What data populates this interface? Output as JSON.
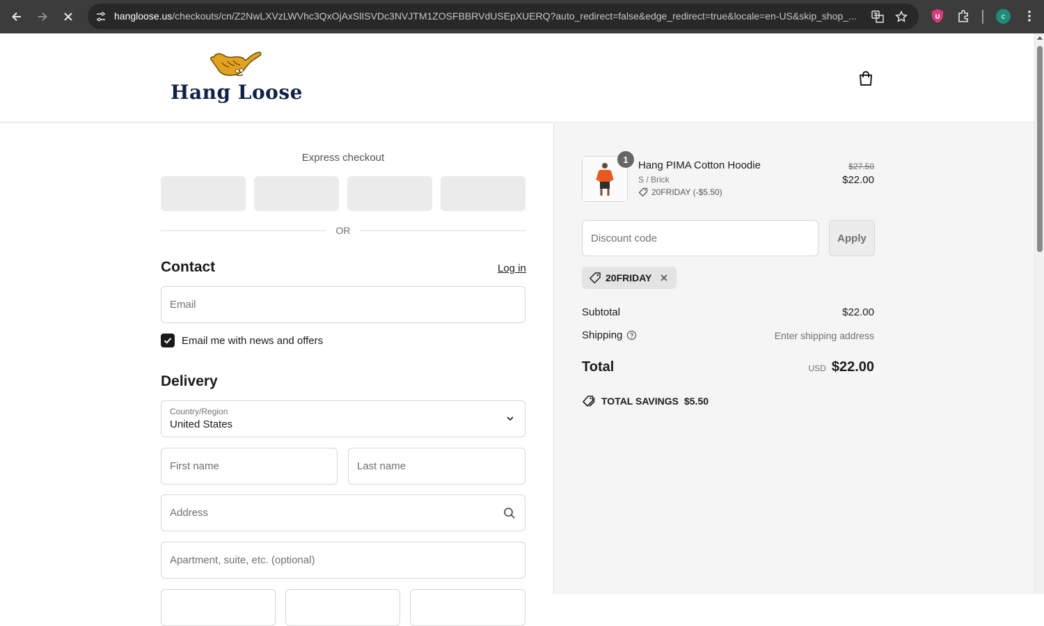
{
  "browser": {
    "url_host": "hangloose.us",
    "url_path": "/checkouts/cn/Z2NwLXVzLWVhc3QxOjAxSlISVDc3NVJTM1ZOSFBBRVdUSEpXUERQ?auto_redirect=false&edge_redirect=true&locale=en-US&skip_shop_...",
    "profile_initial": "c"
  },
  "shop": {
    "logo_text": "Hang Loose"
  },
  "express": {
    "title": "Express checkout",
    "separator": "OR"
  },
  "contact": {
    "title": "Contact",
    "login_label": "Log in",
    "email_placeholder": "Email",
    "newsletter_label": "Email me with news and offers",
    "newsletter_checked": true
  },
  "delivery": {
    "title": "Delivery",
    "country_label": "Country/Region",
    "country_value": "United States",
    "first_name_placeholder": "First name",
    "last_name_placeholder": "Last name",
    "address_placeholder": "Address",
    "apartment_placeholder": "Apartment, suite, etc. (optional)"
  },
  "summary": {
    "item": {
      "name": "Hang PIMA Cotton Hoodie",
      "variant": "S / Brick",
      "discount": "20FRIDAY (-$5.50)",
      "quantity": "1",
      "original_price": "$27.50",
      "price": "$22.00"
    },
    "discount_placeholder": "Discount code",
    "apply_label": "Apply",
    "applied_code": "20FRIDAY",
    "subtotal_label": "Subtotal",
    "subtotal_value": "$22.00",
    "shipping_label": "Shipping",
    "shipping_value": "Enter shipping address",
    "total_label": "Total",
    "total_currency": "USD",
    "total_value": "$22.00",
    "savings_label": "TOTAL SAVINGS",
    "savings_value": "$5.50"
  },
  "colors": {
    "brand_navy": "#0f2147",
    "brand_gold": "#e0a21f",
    "summary_bg": "#f5f5f5"
  }
}
